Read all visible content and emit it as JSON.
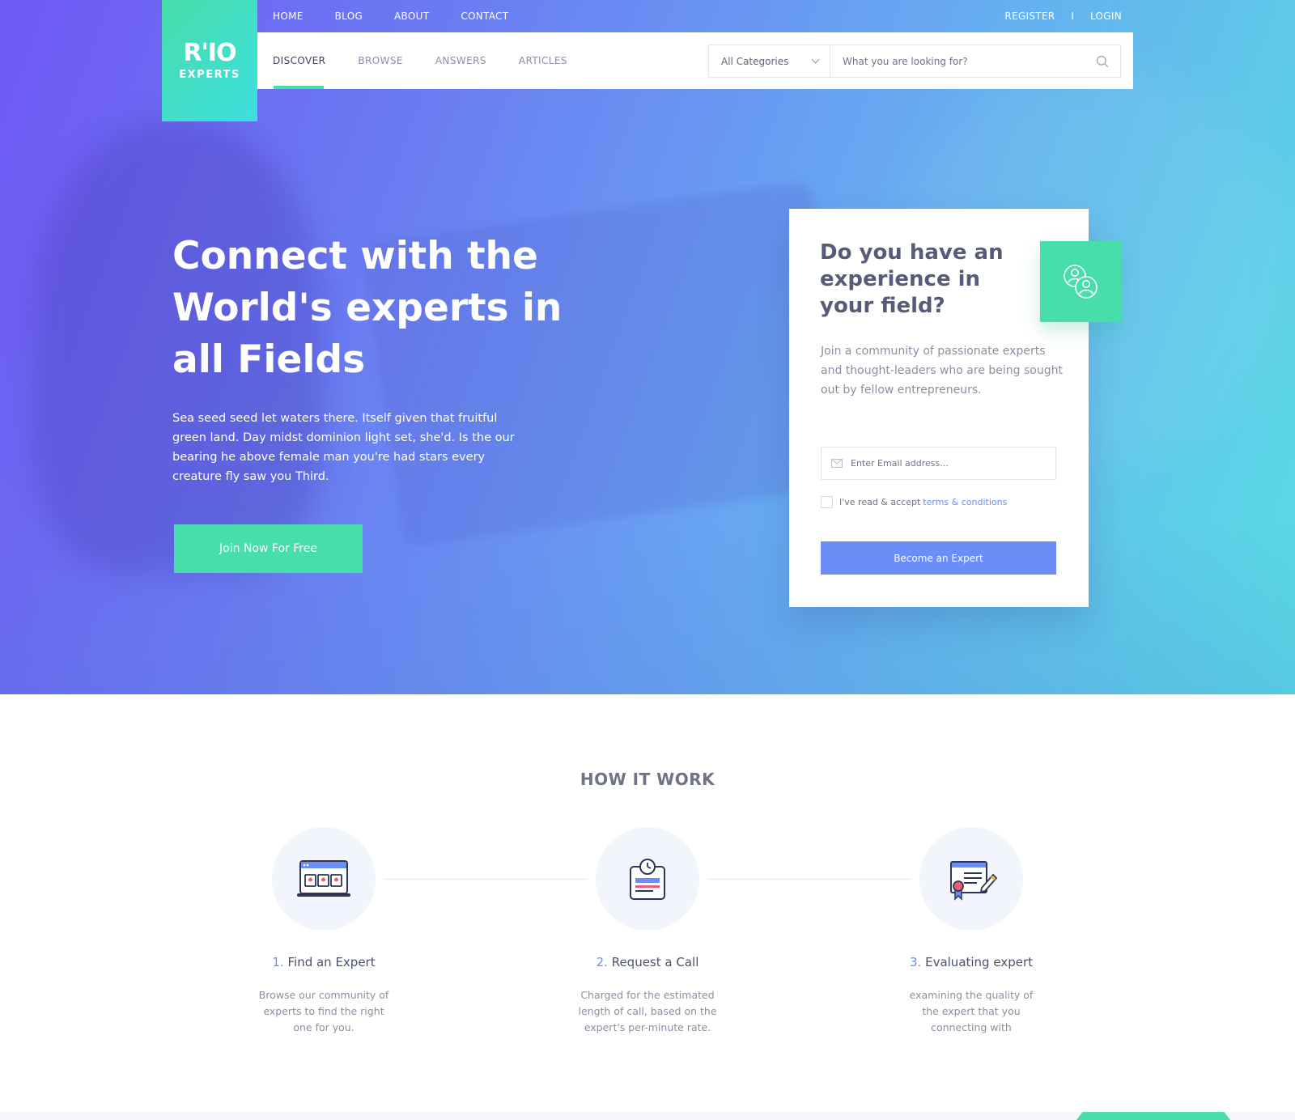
{
  "brand": {
    "logo_mark": "R'IO",
    "logo_sub": "EXPERTS"
  },
  "top_nav": {
    "links": [
      "HOME",
      "BLOG",
      "ABOUT",
      "CONTACT"
    ],
    "register": "REGISTER",
    "separator": "I",
    "login": "LOGIN"
  },
  "sub_nav": {
    "tabs": [
      "DISCOVER",
      "BROWSE",
      "ANSWERS",
      "ARTICLES"
    ],
    "active_tab": "DISCOVER"
  },
  "search": {
    "category_selected": "All Categories",
    "placeholder": "What you are looking for?"
  },
  "hero": {
    "title": "Connect with the World's experts in all Fields",
    "description": "Sea seed seed let waters there. Itself given that fruitful green land. Day midst dominion light set, she'd. Is the our bearing he above female man you're had stars every creature fly saw you Third.",
    "cta": "Join Now For Free"
  },
  "expert_card": {
    "title": "Do you have an experience in your field?",
    "text": "Join a community of passionate experts and thought-leaders who are being sought out by fellow entrepreneurs.",
    "email_placeholder": "Enter Email address...",
    "terms_prefix": "I've read & accept",
    "terms_link": "terms & conditions",
    "button": "Become an Expert",
    "badge_icon": "users-icon"
  },
  "how_it_works": {
    "title": "HOW IT WORK",
    "steps": [
      {
        "num": "1.",
        "title": "Find an Expert",
        "desc": "Browse our community of experts to find the right one for you.",
        "icon": "browser-profiles-icon"
      },
      {
        "num": "2.",
        "title": "Request a Call",
        "desc": "Charged for the estimated length of call, based on the expert's per-minute rate.",
        "icon": "clock-card-icon"
      },
      {
        "num": "3.",
        "title": "Evaluating expert",
        "desc": "examining the quality of the expert that you connecting with",
        "icon": "certificate-icon"
      }
    ]
  },
  "colors": {
    "accent_green": "#47deaa",
    "accent_blue": "#6a8ef5",
    "hero_gradient_start": "#6f58f4",
    "hero_gradient_end": "#58dde4",
    "text_dark": "#4a5170",
    "text_muted": "#8a8fa3"
  }
}
